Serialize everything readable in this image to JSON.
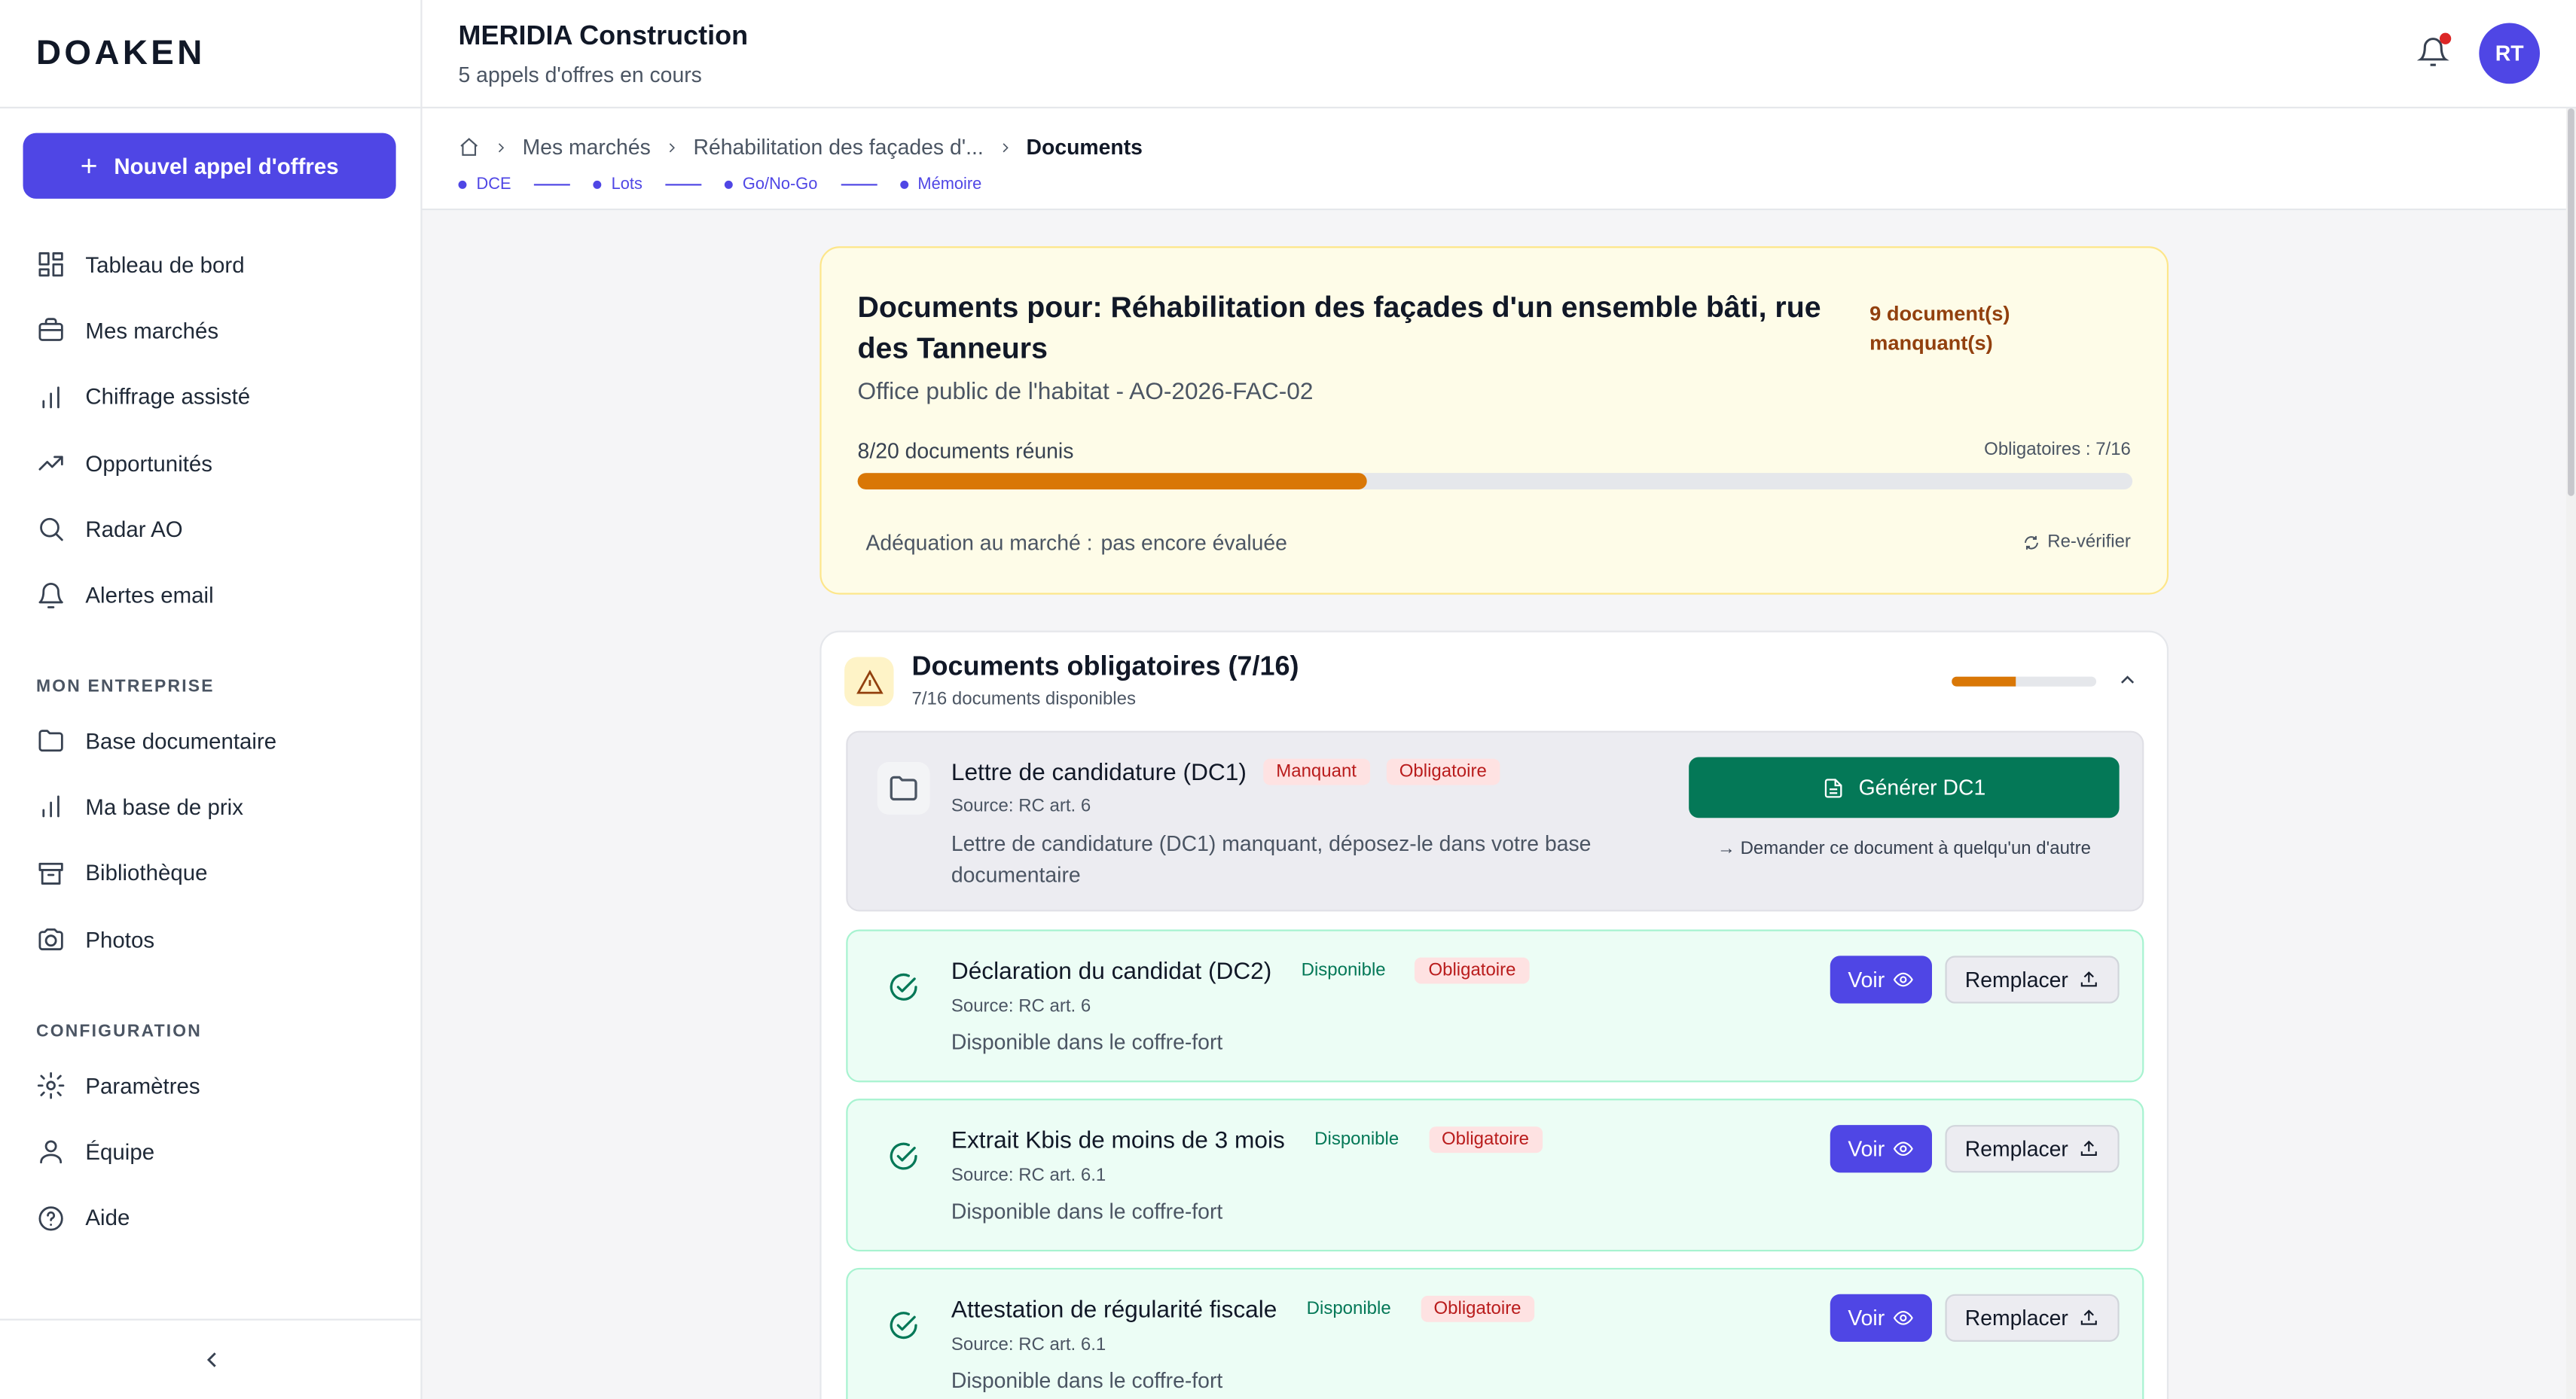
{
  "brand": {
    "logo": "DOAKEN"
  },
  "sidebar": {
    "new_button": "Nouvel appel d'offres",
    "main_items": [
      {
        "label": "Tableau de bord",
        "icon": "dashboard-icon"
      },
      {
        "label": "Mes marchés",
        "icon": "briefcase-icon"
      },
      {
        "label": "Chiffrage assisté",
        "icon": "bar-chart-icon"
      },
      {
        "label": "Opportunités",
        "icon": "trending-up-icon"
      },
      {
        "label": "Radar AO",
        "icon": "search-icon"
      },
      {
        "label": "Alertes email",
        "icon": "bell-icon"
      }
    ],
    "section_company": "MON ENTREPRISE",
    "company_items": [
      {
        "label": "Base documentaire",
        "icon": "folder-icon"
      },
      {
        "label": "Ma base de prix",
        "icon": "bar-chart-icon"
      },
      {
        "label": "Bibliothèque",
        "icon": "archive-icon"
      },
      {
        "label": "Photos",
        "icon": "camera-icon"
      }
    ],
    "section_config": "CONFIGURATION",
    "config_items": [
      {
        "label": "Paramètres",
        "icon": "gear-icon"
      },
      {
        "label": "Équipe",
        "icon": "user-icon"
      },
      {
        "label": "Aide",
        "icon": "help-icon"
      }
    ]
  },
  "header": {
    "company": "MERIDIA Construction",
    "subtitle": "5 appels d'offres en cours",
    "avatar": "RT",
    "has_notification": true
  },
  "breadcrumb": {
    "items": [
      "Mes marchés",
      "Réhabilitation des façades d'...",
      "Documents"
    ]
  },
  "steps": [
    "DCE",
    "Lots",
    "Go/No-Go",
    "Mémoire"
  ],
  "summary": {
    "title": "Documents pour: Réhabilitation des façades d'un ensemble bâti, rue des Tanneurs",
    "org": "Office public de l'habitat - AO-2026-FAC-02",
    "missing": "9 document(s) manquant(s)",
    "count_text": "8/20 documents réunis",
    "progress": 0.4,
    "oblig_text": "Obligatoires : 7/16",
    "adequation_label": "Adéquation au marché :",
    "adequation_value": "pas encore évaluée",
    "recheck": "Re-vérifier"
  },
  "mandatory": {
    "title": "Documents obligatoires (7/16)",
    "subtitle": "7/16 documents disponibles",
    "progress": 0.4375,
    "documents": [
      {
        "name": "Lettre de candidature (DC1)",
        "status": "Manquant",
        "tag": "Obligatoire",
        "source": "Source: RC art. 6",
        "desc": "Lettre de candidature (DC1) manquant, déposez-le dans votre base documentaire",
        "generate": "Générer DC1",
        "ask": "Demander ce document à quelqu'un d'autre"
      },
      {
        "name": "Déclaration du candidat (DC2)",
        "status": "Disponible",
        "tag": "Obligatoire",
        "source": "Source: RC art. 6",
        "desc": "Disponible dans le coffre-fort",
        "view": "Voir",
        "replace": "Remplacer"
      },
      {
        "name": "Extrait Kbis de moins de 3 mois",
        "status": "Disponible",
        "tag": "Obligatoire",
        "source": "Source: RC art. 6.1",
        "desc": "Disponible dans le coffre-fort",
        "view": "Voir",
        "replace": "Remplacer"
      },
      {
        "name": "Attestation de régularité fiscale",
        "status": "Disponible",
        "tag": "Obligatoire",
        "source": "Source: RC art. 6.1",
        "desc": "Disponible dans le coffre-fort",
        "view": "Voir",
        "replace": "Remplacer"
      }
    ]
  },
  "colors": {
    "primary": "#4f46e5",
    "success": "#047857",
    "warning": "#d97706",
    "danger": "#b91c1c"
  }
}
